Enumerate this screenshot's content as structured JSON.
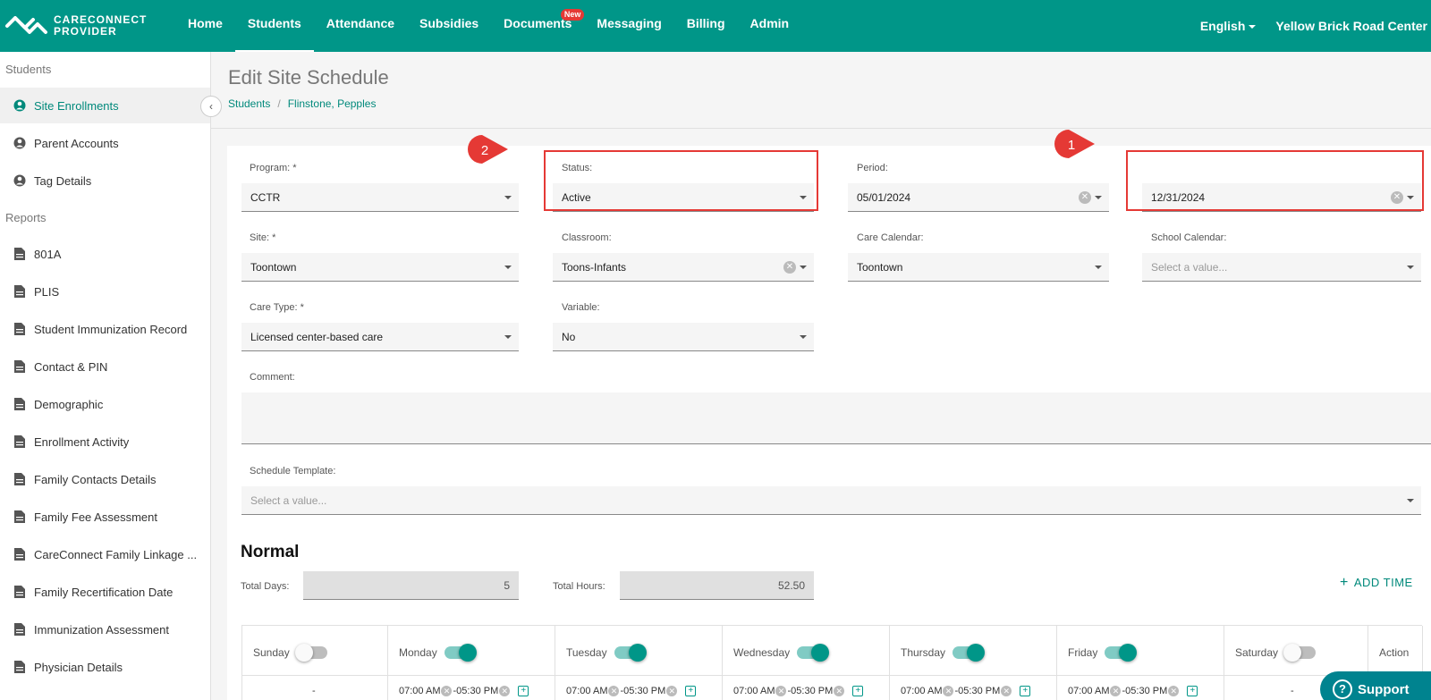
{
  "app": {
    "brand_line1": "CARECONNECT",
    "brand_line2": "PROVIDER"
  },
  "nav": {
    "items": [
      {
        "label": "Home"
      },
      {
        "label": "Students"
      },
      {
        "label": "Attendance"
      },
      {
        "label": "Subsidies"
      },
      {
        "label": "Documents",
        "badge": "New"
      },
      {
        "label": "Messaging"
      },
      {
        "label": "Billing"
      },
      {
        "label": "Admin"
      }
    ],
    "language": "English",
    "center": "Yellow Brick Road Center"
  },
  "sidebar": {
    "students_header": "Students",
    "students_items": [
      {
        "label": "Site Enrollments"
      },
      {
        "label": "Parent Accounts"
      },
      {
        "label": "Tag Details"
      }
    ],
    "reports_header": "Reports",
    "reports_items": [
      {
        "label": "801A"
      },
      {
        "label": "PLIS"
      },
      {
        "label": "Student Immunization Record"
      },
      {
        "label": "Contact & PIN"
      },
      {
        "label": "Demographic"
      },
      {
        "label": "Enrollment Activity"
      },
      {
        "label": "Family Contacts Details"
      },
      {
        "label": "Family Fee Assessment"
      },
      {
        "label": "CareConnect Family Linkage ..."
      },
      {
        "label": "Family Recertification Date"
      },
      {
        "label": "Immunization Assessment"
      },
      {
        "label": "Physician Details"
      }
    ]
  },
  "page": {
    "title": "Edit Site Schedule",
    "breadcrumb": [
      "Students",
      "Flinstone, Pepples"
    ]
  },
  "form": {
    "program": {
      "label": "Program: *",
      "value": "CCTR"
    },
    "status": {
      "label": "Status:",
      "value": "Active"
    },
    "period": {
      "label": "Period:",
      "start": "05/01/2024",
      "end": "12/31/2024"
    },
    "site": {
      "label": "Site: *",
      "value": "Toontown"
    },
    "classroom": {
      "label": "Classroom:",
      "value": "Toons-Infants"
    },
    "care_calendar": {
      "label": "Care Calendar:",
      "value": "Toontown"
    },
    "school_calendar": {
      "label": "School Calendar:",
      "placeholder": "Select a value..."
    },
    "care_type": {
      "label": "Care Type: *",
      "value": "Licensed center-based care"
    },
    "variable": {
      "label": "Variable:",
      "value": "No"
    },
    "comment": {
      "label": "Comment:"
    },
    "schedule_template": {
      "label": "Schedule Template:",
      "placeholder": "Select a value..."
    }
  },
  "annotations": {
    "badge1": "1",
    "badge2": "2"
  },
  "schedule": {
    "title": "Normal",
    "total_days_label": "Total Days:",
    "total_days": "5",
    "total_hours_label": "Total Hours:",
    "total_hours": "52.50",
    "add_time": "ADD TIME",
    "action_label": "Action",
    "days": [
      {
        "name": "Sunday",
        "on": false,
        "time": "-"
      },
      {
        "name": "Monday",
        "on": true,
        "start": "07:00 AM",
        "end": "05:30 PM"
      },
      {
        "name": "Tuesday",
        "on": true,
        "start": "07:00 AM",
        "end": "05:30 PM"
      },
      {
        "name": "Wednesday",
        "on": true,
        "start": "07:00 AM",
        "end": "05:30 PM"
      },
      {
        "name": "Thursday",
        "on": true,
        "start": "07:00 AM",
        "end": "05:30 PM"
      },
      {
        "name": "Friday",
        "on": true,
        "start": "07:00 AM",
        "end": "05:30 PM"
      },
      {
        "name": "Saturday",
        "on": false,
        "time": "-"
      }
    ]
  },
  "support": {
    "label": "Support"
  },
  "colors": {
    "brand": "#009688",
    "highlight": "#e53935",
    "link": "#00897b"
  }
}
